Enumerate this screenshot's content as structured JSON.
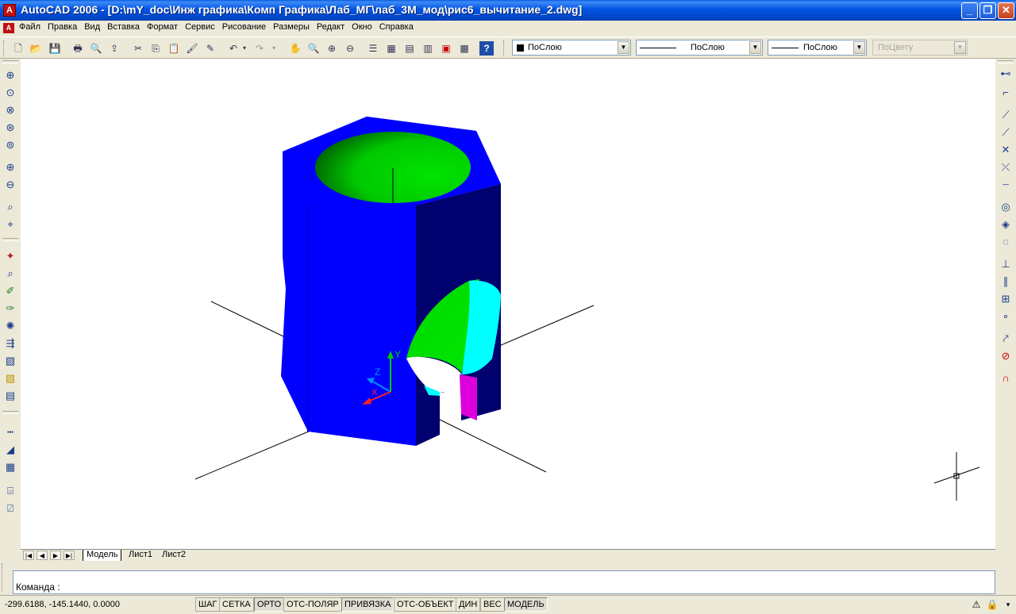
{
  "window": {
    "title": "AutoCAD 2006 - [D:\\mY_doc\\Инж графика\\Комп Графика\\Лаб_МГ\\лаб_3М_мод\\рис6_вычитание_2.dwg]",
    "app_icon": "A"
  },
  "menu": {
    "items": [
      "Файл",
      "Правка",
      "Вид",
      "Вставка",
      "Формат",
      "Сервис",
      "Рисование",
      "Размеры",
      "Редакт",
      "Окно",
      "Справка"
    ]
  },
  "properties": {
    "layer": "ПоСлою",
    "linetype": "ПоСлою",
    "lineweight": "ПоСлою",
    "plotstyle": "ПоЦвету"
  },
  "icons": {
    "standard_toolbar": [
      "new-icon",
      "open-icon",
      "save-icon",
      "plot-icon",
      "plot-preview-icon",
      "publish-icon",
      "cut-icon",
      "copy-icon",
      "paste-icon",
      "match-properties-icon",
      "block-editor-icon",
      "undo-icon",
      "redo-icon",
      "pan-icon",
      "zoom-realtime-icon",
      "zoom-window-icon",
      "zoom-previous-icon",
      "properties-icon",
      "design-center-icon",
      "tool-palettes-icon",
      "sheet-set-icon",
      "markup-icon",
      "quickcalc-icon",
      "help-icon"
    ],
    "left_toolbar": [
      "zoom-window-icon",
      "zoom-dynamic-icon",
      "zoom-scale-icon",
      "zoom-center-icon",
      "zoom-object-icon",
      "zoom-in-icon",
      "zoom-out-icon",
      "zoom-all-icon",
      "zoom-extents-icon",
      "orbit-icon",
      "zoom-icon",
      "view-icon",
      "render-icon",
      "light-icon",
      "scene-icon",
      "material-icon",
      "landscape-icon",
      "fog-icon",
      "dimension-icon",
      "ruler-icon",
      "layer-icon",
      "tolerance-icon",
      "measure-icon"
    ],
    "right_toolbar": [
      "endpoint-snap-icon",
      "midpoint-snap-icon",
      "intersection-snap-icon",
      "apparent-intersection-icon",
      "extension-snap-icon",
      "center-snap-icon",
      "quadrant-snap-icon",
      "tangent-snap-icon",
      "perpendicular-snap-icon",
      "parallel-snap-icon",
      "insert-snap-icon",
      "node-snap-icon",
      "nearest-snap-icon",
      "none-snap-icon",
      "osnap-settings-icon"
    ]
  },
  "viewport": {
    "ucs_labels": {
      "x": "X",
      "y": "Y",
      "z": "Z"
    },
    "colors": {
      "solid_front": "#0000ff",
      "solid_side": "#00006e",
      "inner_green": "#00dd00",
      "inner_cyan": "#00ffff",
      "inner_magenta": "#dd00dd"
    }
  },
  "tabs": {
    "items": [
      "Модель",
      "Лист1",
      "Лист2"
    ],
    "active": "Модель"
  },
  "command": {
    "prompt": "Команда :"
  },
  "status": {
    "coords": "-299.6188, -145.1440, 0.0000",
    "buttons": [
      "ШАГ",
      "СЕТКА",
      "ОРТО",
      "ОТС-ПОЛЯР",
      "ПРИВЯЗКА",
      "ОТС-ОБЪЕКТ",
      "ДИН",
      "ВЕС",
      "МОДЕЛЬ"
    ]
  }
}
